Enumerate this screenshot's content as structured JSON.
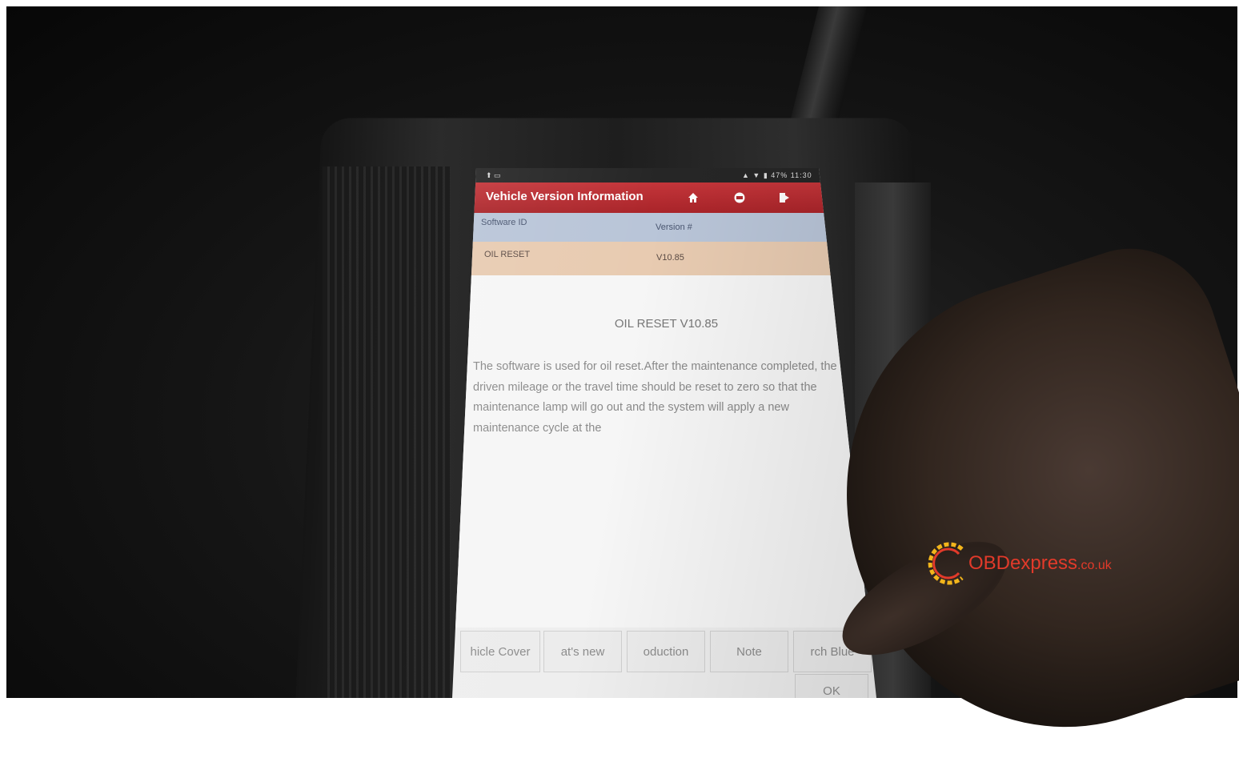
{
  "status_bar": {
    "left": "⬆ ▭",
    "right": "▲ ▼ ▮ 47% 11:30"
  },
  "header": {
    "title": "Vehicle Version Information",
    "icons": [
      "home-icon",
      "print-icon",
      "exit-icon"
    ]
  },
  "table": {
    "columns": [
      "Software ID",
      "Version #"
    ],
    "rows": [
      {
        "software_id": "OIL RESET",
        "version": "V10.85"
      }
    ]
  },
  "detail": {
    "heading": "OIL RESET V10.85",
    "description": "The software is used for oil reset.After the maintenance completed, the driven mileage or the travel time should be reset to zero so that the maintenance lamp will go out and the system will apply a new maintenance cycle at the"
  },
  "buttons": [
    {
      "label": "hicle Cover"
    },
    {
      "label": "at's new"
    },
    {
      "label": "oduction"
    },
    {
      "label": "Note"
    },
    {
      "label": "rch Blue"
    }
  ],
  "ok_label": "OK",
  "watermark": {
    "brand": "OBDexpress",
    "suffix": ".co.uk"
  },
  "colors": {
    "title_bar": "#b22a2f",
    "table_header": "#b9c5d8",
    "table_row": "#e8cbb1",
    "watermark": "#e23a2a"
  }
}
